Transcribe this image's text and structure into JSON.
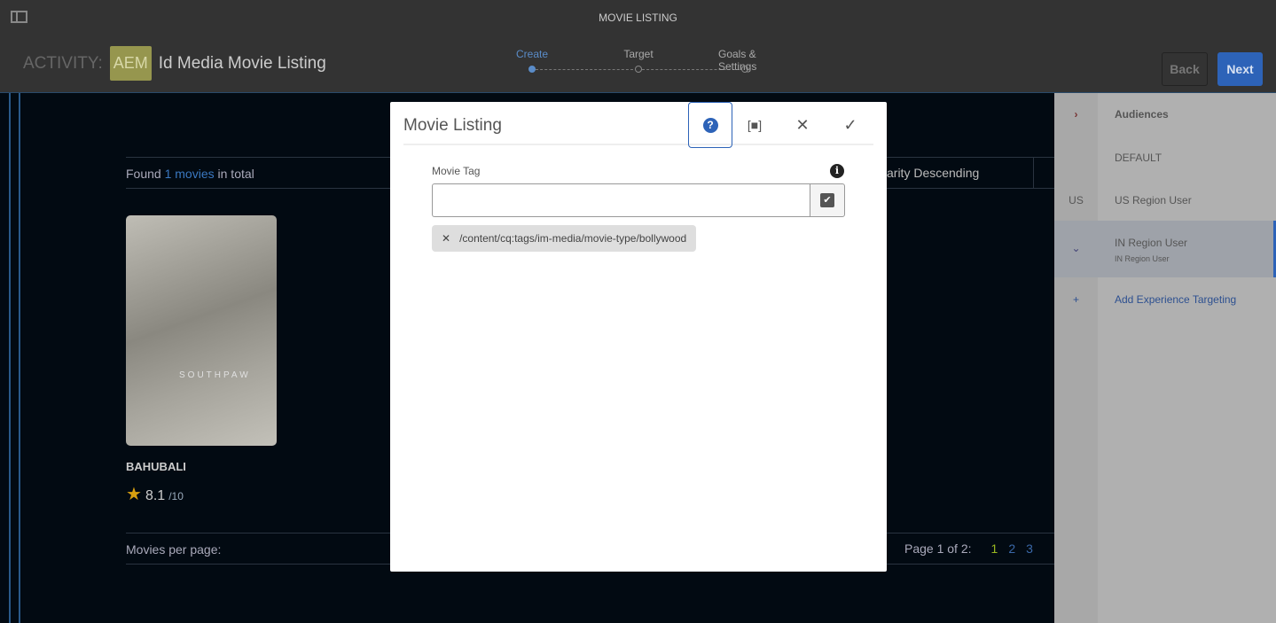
{
  "window": {
    "title": "MOVIE LISTING"
  },
  "activity": {
    "label": "ACTIVITY:",
    "badge": "AEM",
    "name": "Id Media Movie Listing"
  },
  "steps": [
    {
      "label": "Create"
    },
    {
      "label": "Target"
    },
    {
      "label": "Goals & Settings"
    }
  ],
  "buttons": {
    "back": "Back",
    "next": "Next"
  },
  "listing": {
    "found_prefix": "Found",
    "found_count": "1 movies",
    "found_suffix": "in total",
    "sort": "arity Descending",
    "per_page": "Movies per page:",
    "page_info": "Page 1 of 2:",
    "pages": [
      "1",
      "2",
      "3"
    ]
  },
  "movie": {
    "poster_text": "SOUTHPAW",
    "title": "BAHUBALI",
    "rating": "8.1",
    "rating_max": "/10"
  },
  "panel": {
    "header": "Audiences",
    "items": [
      {
        "icon": "",
        "label": "DEFAULT"
      },
      {
        "icon": "US",
        "label": "US Region User"
      },
      {
        "icon": "⌄",
        "label": "IN Region User",
        "sub": "IN Region User"
      },
      {
        "icon": "+",
        "label": "Add Experience Targeting"
      }
    ]
  },
  "dialog": {
    "title": "Movie Listing",
    "field_label": "Movie Tag",
    "field_value": "",
    "tag": "/content/cq:tags/im-media/movie-type/bollywood"
  },
  "colors": {
    "accent": "#2d63b8",
    "aem": "#96964e",
    "current_page": "#9ab820"
  }
}
